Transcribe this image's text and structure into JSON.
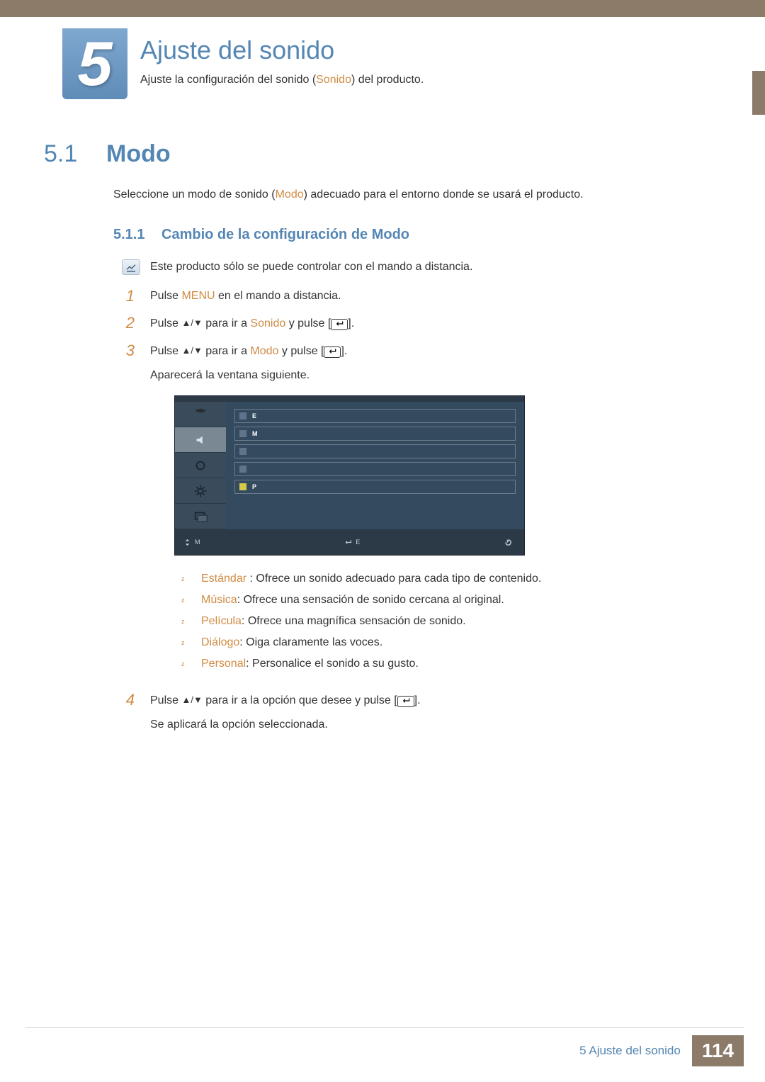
{
  "chapter": {
    "number": "5",
    "title": "Ajuste del sonido",
    "intro_pre": "Ajuste la configuración del sonido (",
    "intro_hl": "Sonido",
    "intro_post": ") del producto."
  },
  "section": {
    "number": "5.1",
    "title": "Modo",
    "desc_pre": "Seleccione un modo de sonido (",
    "desc_hl": "Modo",
    "desc_post": ") adecuado para el entorno donde se usará el producto."
  },
  "subsection": {
    "number": "5.1.1",
    "title": "Cambio de la configuración de Modo"
  },
  "note": "Este producto sólo se puede controlar con el mando a distancia.",
  "steps": {
    "s1": {
      "num": "1",
      "a": "Pulse ",
      "hl": "MENU",
      "b": " en el mando a distancia."
    },
    "s2": {
      "num": "2",
      "a": "Pulse ",
      "tri": "▲/▼",
      "b": " para ir a ",
      "hl": "Sonido",
      "c": " y pulse [",
      "d": "]."
    },
    "s3": {
      "num": "3",
      "a": "Pulse ",
      "tri": "▲/▼",
      "b": " para ir a ",
      "hl": "Modo",
      "c": " y pulse [",
      "d": "].",
      "after": "Aparecerá la ventana siguiente."
    },
    "s4": {
      "num": "4",
      "a": "Pulse ",
      "tri": "▲/▼",
      "b": " para ir a la opción que desee y pulse [",
      "c": "].",
      "after": "Se aplicará la opción seleccionada."
    }
  },
  "osd": {
    "title": " ",
    "rows": [
      {
        "first": "E",
        "rest": " "
      },
      {
        "first": "M",
        "rest": " "
      },
      {
        "first": "",
        "rest": " "
      },
      {
        "first": "",
        "rest": " "
      },
      {
        "first": "P",
        "rest": " ",
        "check": true
      }
    ],
    "foot": {
      "move": "M",
      "enter": "E",
      "return": " "
    }
  },
  "bullets": [
    {
      "hl": "Estándar",
      "sep": " : ",
      "text": "Ofrece un sonido adecuado para cada tipo de contenido."
    },
    {
      "hl": "Música",
      "sep": ": ",
      "text": "Ofrece una sensación de sonido cercana al original."
    },
    {
      "hl": "Película",
      "sep": ": ",
      "text": "Ofrece una magnífica sensación de sonido."
    },
    {
      "hl": "Diálogo",
      "sep": ": ",
      "text": "Oiga claramente las voces."
    },
    {
      "hl": "Personal",
      "sep": ": ",
      "text": "Personalice el sonido a su gusto."
    }
  ],
  "footer": {
    "text": "5 Ajuste del sonido",
    "page": "114"
  }
}
